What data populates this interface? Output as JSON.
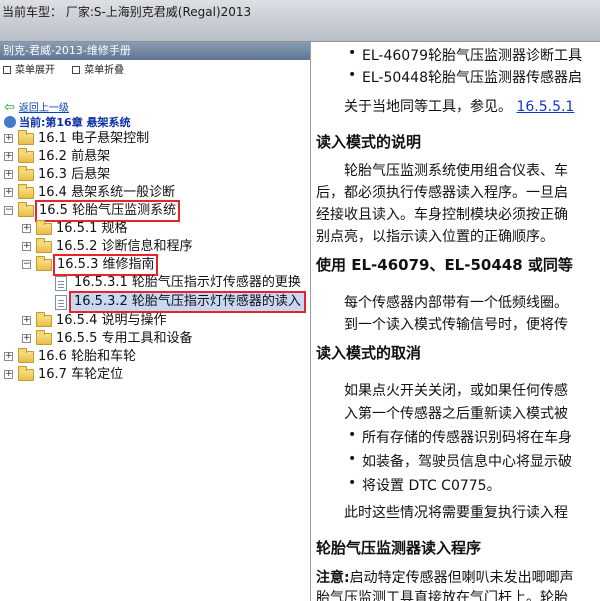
{
  "header": {
    "title": "当前车型：  厂家:S-上海别克君威(Regal)2013"
  },
  "left_panel": {
    "title": "别克-君威-2013-维修手册",
    "menu": {
      "expand": "菜单展开",
      "collapse": "菜单折叠"
    },
    "back_link": "返回上一级",
    "current_chapter": "当前:第16章 悬架系统",
    "tree": [
      {
        "id": "16_1",
        "label": "16.1 电子悬架控制"
      },
      {
        "id": "16_2",
        "label": "16.2 前悬架"
      },
      {
        "id": "16_3",
        "label": "16.3 后悬架"
      },
      {
        "id": "16_4",
        "label": "16.4 悬架系统一般诊断"
      },
      {
        "id": "16_5",
        "label": "16.5 轮胎气压监测系统"
      },
      {
        "id": "16_5_1",
        "label": "16.5.1 规格"
      },
      {
        "id": "16_5_2",
        "label": "16.5.2 诊断信息和程序"
      },
      {
        "id": "16_5_3",
        "label": "16.5.3 维修指南"
      },
      {
        "id": "16_5_3_1",
        "label": "16.5.3.1 轮胎气压指示灯传感器的更换"
      },
      {
        "id": "16_5_3_2",
        "label": "16.5.3.2 轮胎气压指示灯传感器的读入"
      },
      {
        "id": "16_5_4",
        "label": "16.5.4 说明与操作"
      },
      {
        "id": "16_5_5",
        "label": "16.5.5 专用工具和设备"
      },
      {
        "id": "16_6",
        "label": "16.6 轮胎和车轮"
      },
      {
        "id": "16_7",
        "label": "16.7 车轮定位"
      }
    ]
  },
  "content": {
    "tool1": "EL-46079轮胎气压监测器诊断工具",
    "tool2": "EL-50448轮胎气压监测器传感器启",
    "ref_text": "关于当地同等工具，参见。",
    "ref_link": "16.5.5.1",
    "h_learn_mode": "读入模式的说明",
    "p1_line1": "轮胎气压监测系统使用组合仪表、车",
    "p1_line2": "后，都必须执行传感器读入程序。一旦启",
    "p1_line3": "经接收且读入。车身控制模块必须按正确",
    "p1_line4": "别点亮，以指示读入位置的正确顺序。",
    "h_using": "使用 EL-46079、EL-50448 或同等",
    "p2_line1": "每个传感器内部带有一个低频线圈。",
    "p2_line2": "到一个读入模式传输信号时，便将传",
    "h_cancel": "读入模式的取消",
    "p3_line1": "如果点火开关关闭，或如果任何传感",
    "p3_line2": "入第一个传感器之后重新读入模式被",
    "b1": "所有存储的传感器识别码将在车身",
    "b2": "如装备，驾驶员信息中心将显示破",
    "b3": "将设置 DTC C0775。",
    "p4": "此时这些情况将需要重复执行读入程",
    "h_proc": "轮胎气压监测器读入程序",
    "note_label": "注意:",
    "note_line1": "启动特定传感器但喇叭未发出唧唧声",
    "note_line2": "胎气压监测工具直接放在气门杆上。轮胎"
  }
}
